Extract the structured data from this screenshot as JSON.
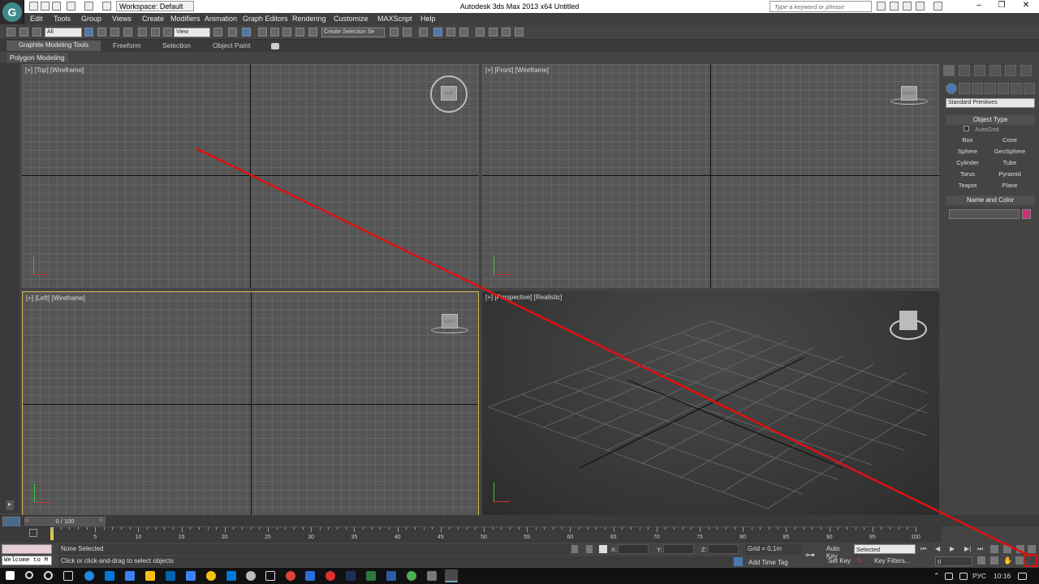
{
  "titlebar": {
    "workspace": "Workspace: Default",
    "app_title": "Autodesk 3ds Max  2013 x64      Untitled",
    "search_placeholder": "Type a keyword or phrase"
  },
  "menu": [
    "Edit",
    "Tools",
    "Group",
    "Views",
    "Create",
    "Modifiers",
    "Animation",
    "Graph Editors",
    "Rendering",
    "Customize",
    "MAXScript",
    "Help"
  ],
  "toolbar": {
    "filter": "All",
    "ref_coord": "View",
    "selection_set": "Create Selection Se"
  },
  "ribbon": {
    "tabs": [
      "Graphite Modeling Tools",
      "Freeform",
      "Selection",
      "Object Paint"
    ],
    "subtab": "Polygon Modeling"
  },
  "viewports": {
    "top": "[+] [Top] [Wireframe]",
    "front": "[+] [Front] [Wireframe]",
    "left": "[+] [Left] [Wireframe]",
    "perspective": "[+] [Perspective] [Realistic]",
    "cube_top": "TOP",
    "cube_front": "FRONT",
    "cube_left": "LEFT"
  },
  "command_panel": {
    "category": "Standard Primitives",
    "object_type": "Object Type",
    "autogrid": "AutoGrid",
    "buttons": [
      "Box",
      "Cone",
      "Sphere",
      "GeoSphere",
      "Cylinder",
      "Tube",
      "Torus",
      "Pyramid",
      "Teapot",
      "Plane"
    ],
    "name_color": "Name and Color",
    "object_color": "#c8307a"
  },
  "timeline": {
    "frame": "0 / 100",
    "ticks": [
      "5",
      "10",
      "15",
      "20",
      "25",
      "30",
      "35",
      "40",
      "45",
      "50",
      "55",
      "60",
      "65",
      "70",
      "75",
      "80",
      "85",
      "90",
      "95",
      "100"
    ]
  },
  "status": {
    "listener": "Welcome to M",
    "selection": "None Selected",
    "prompt": "Click or click-and-drag to select objects",
    "x_label": "X:",
    "y_label": "Y:",
    "z_label": "Z:",
    "grid": "Grid = 0,1m",
    "add_time_tag": "Add Time Tag",
    "auto_key": "Auto Key",
    "set_key": "Set Key",
    "selected": "Selected",
    "key_filters": "Key Filters...",
    "frame_field": "0"
  },
  "taskbar": {
    "lang": "РУС",
    "time": "10:16"
  },
  "colors": {
    "annotation_line": "#e01010",
    "active_viewport_border": "#c8b84a"
  }
}
